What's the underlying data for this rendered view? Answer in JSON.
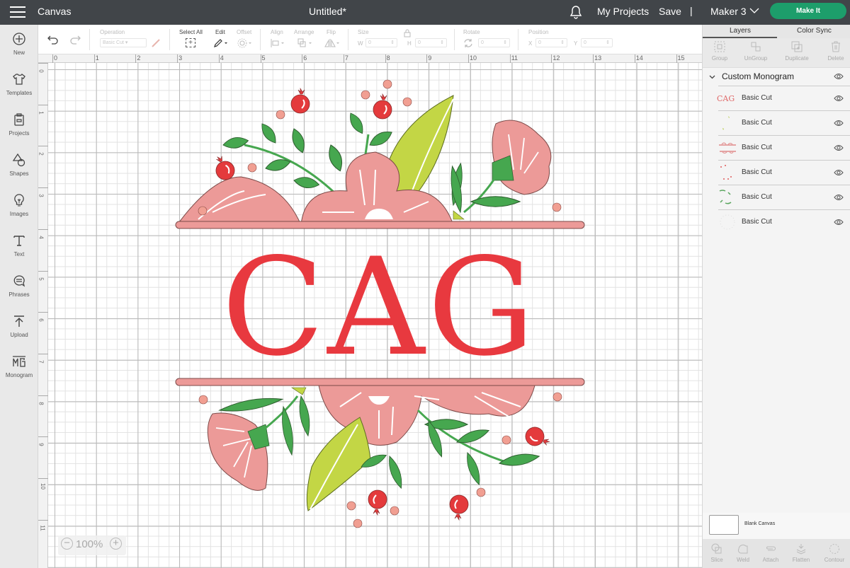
{
  "topbar": {
    "app_name": "Canvas",
    "document_title": "Untitled*",
    "my_projects": "My Projects",
    "save": "Save",
    "separator": "|",
    "machine": "Maker 3",
    "make_it": "Make It",
    "accent_color": "#1d9e6b"
  },
  "sidebar": {
    "items": [
      {
        "label": "New",
        "icon": "plus-circle-icon"
      },
      {
        "label": "Templates",
        "icon": "shirt-icon"
      },
      {
        "label": "Projects",
        "icon": "projects-icon"
      },
      {
        "label": "Shapes",
        "icon": "shapes-icon"
      },
      {
        "label": "Images",
        "icon": "lightbulb-icon"
      },
      {
        "label": "Text",
        "icon": "text-icon"
      },
      {
        "label": "Phrases",
        "icon": "speech-bubble-icon"
      },
      {
        "label": "Upload",
        "icon": "upload-icon"
      },
      {
        "label": "Monogram",
        "icon": "monogram-icon"
      }
    ]
  },
  "toolbar": {
    "operation_label": "Operation",
    "operation_value": "Basic Cut",
    "select_all": "Select All",
    "edit": "Edit",
    "offset": "Offset",
    "align": "Align",
    "arrange": "Arrange",
    "flip": "Flip",
    "size": "Size",
    "w_label": "W",
    "w_value": "0",
    "h_label": "H",
    "h_value": "0",
    "rotate": "Rotate",
    "rotate_value": "0",
    "position": "Position",
    "x_label": "X",
    "x_value": "0",
    "y_label": "Y",
    "y_value": "0"
  },
  "rulers": {
    "horizontal": [
      "0",
      "1",
      "2",
      "3",
      "4",
      "5",
      "6",
      "7",
      "8",
      "9",
      "10",
      "11",
      "12",
      "13",
      "14",
      "15"
    ],
    "vertical": [
      "0",
      "1",
      "2",
      "3",
      "4",
      "5",
      "6",
      "7",
      "8",
      "9",
      "10",
      "11"
    ]
  },
  "canvas": {
    "monogram_letters": "CAG",
    "zoom_level": "100%",
    "colors": {
      "letters": "#e8393f",
      "pink": "#ec9a98",
      "green": "#46a74f",
      "lime": "#c3d645",
      "berry": "#e43a3c",
      "dot": "#f19f92"
    }
  },
  "panel": {
    "tabs": [
      "Layers",
      "Color Sync"
    ],
    "tools": [
      "Group",
      "UnGroup",
      "Duplicate",
      "Delete"
    ],
    "group_name": "Custom Monogram",
    "layers": [
      {
        "name": "Basic Cut",
        "thumb": "CAG"
      },
      {
        "name": "Basic Cut",
        "thumb": ""
      },
      {
        "name": "Basic Cut",
        "thumb": ""
      },
      {
        "name": "Basic Cut",
        "thumb": ""
      },
      {
        "name": "Basic Cut",
        "thumb": ""
      },
      {
        "name": "Basic Cut",
        "thumb": ""
      }
    ],
    "blank_canvas": "Blank Canvas",
    "bottom_tools": [
      "Slice",
      "Weld",
      "Attach",
      "Flatten",
      "Contour"
    ]
  }
}
